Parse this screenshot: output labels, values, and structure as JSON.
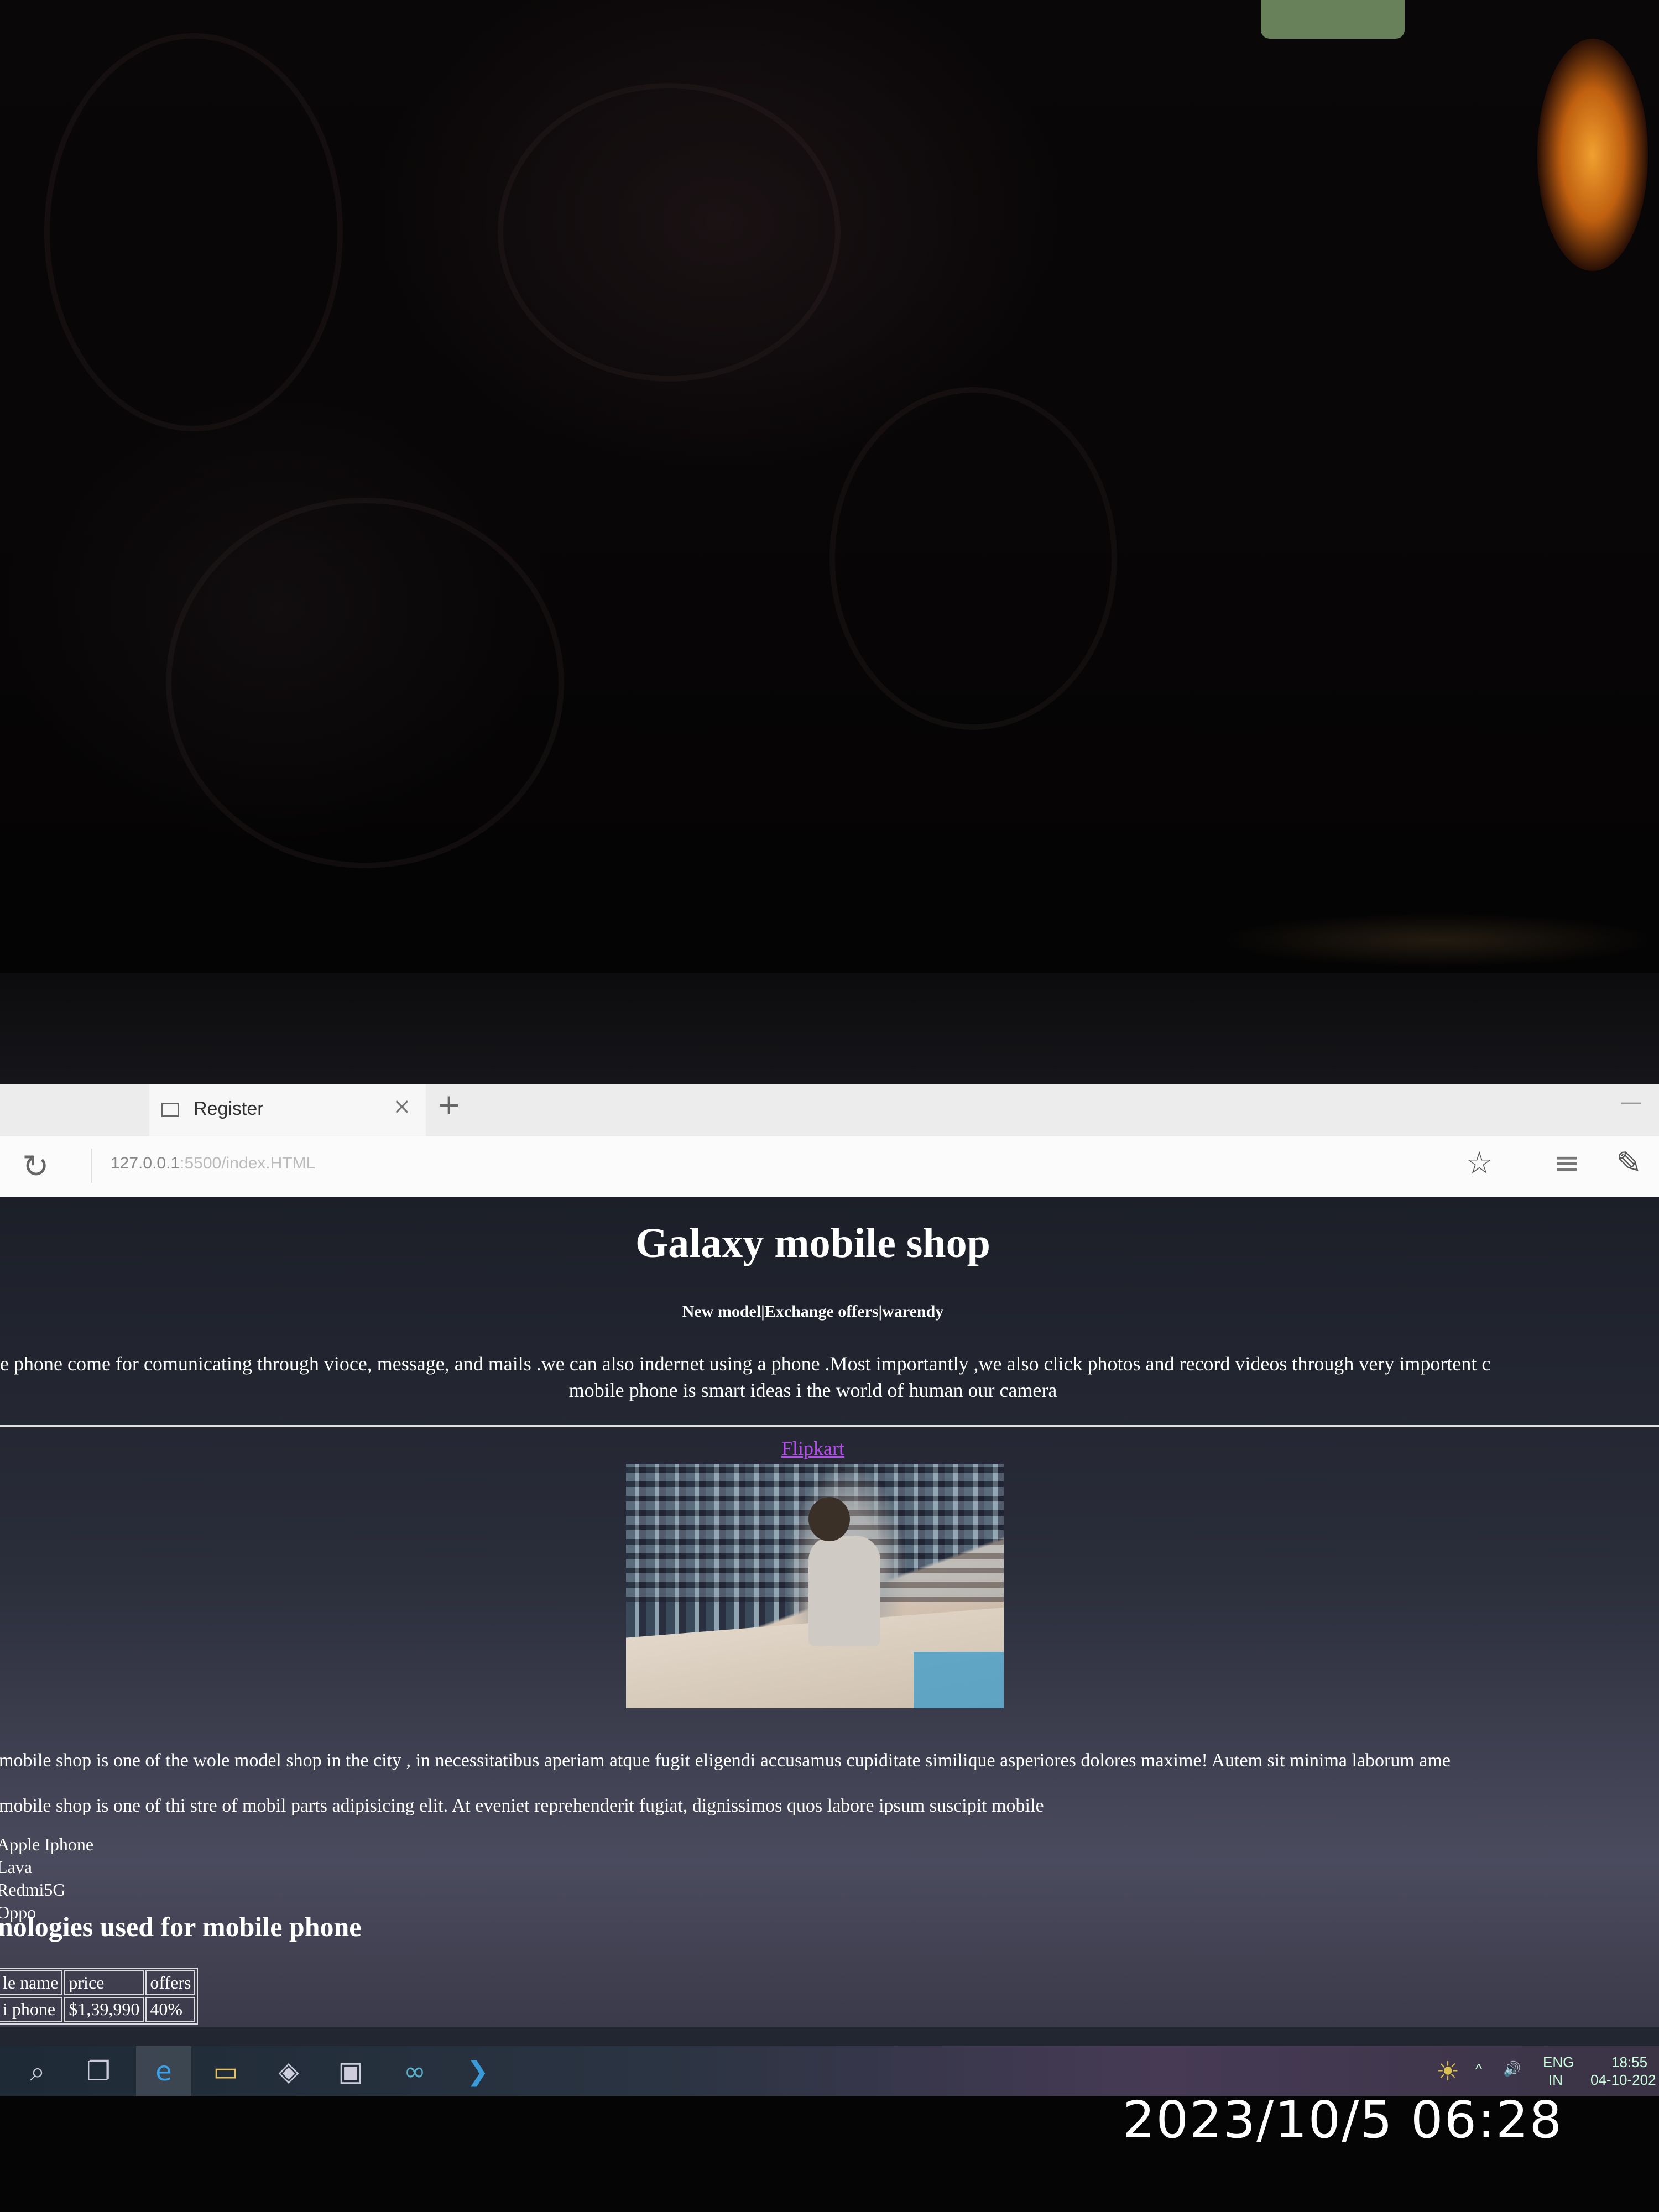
{
  "browser": {
    "tab_title": "Register",
    "close_glyph": "×",
    "new_tab_glyph": "+",
    "address_host": "127.0.0.1",
    "address_rest": ":5500/index.HTML"
  },
  "page": {
    "heading": "Galaxy mobile shop",
    "subnav": "New model|Exchange offers|warendy",
    "intro_line1": "le phone come for comunicating through vioce, message, and mails .we can also indernet using a phone .Most importantly ,we also click photos and record videos through very importent c",
    "intro_line2": "mobile phone is smart ideas i the world of human our camera",
    "link": "Flipkart",
    "para1": "mobile shop is one of the wole model shop in the city , in necessitatibus aperiam atque fugit eligendi accusamus cupiditate similique asperiores dolores maxime! Autem sit minima laborum ame",
    "para2": "mobile shop is one of thi stre of mobil parts adipisicing elit. At eveniet reprehenderit fugiat, dignissimos quos labore ipsum suscipit mobile",
    "brands": [
      "Apple Iphone",
      "Lava",
      "Redmi5G",
      "Oppo"
    ],
    "section_heading": "nologies used for mobile phone",
    "table": {
      "headers": [
        "le name",
        "price",
        "offers"
      ],
      "row": [
        "i phone",
        "$1,39,990",
        "40%"
      ]
    }
  },
  "taskbar": {
    "lang": "ENG",
    "region": "IN",
    "time": "18:55",
    "date": "04-10-202"
  },
  "camera_stamp": "2023/10/5  06:28"
}
